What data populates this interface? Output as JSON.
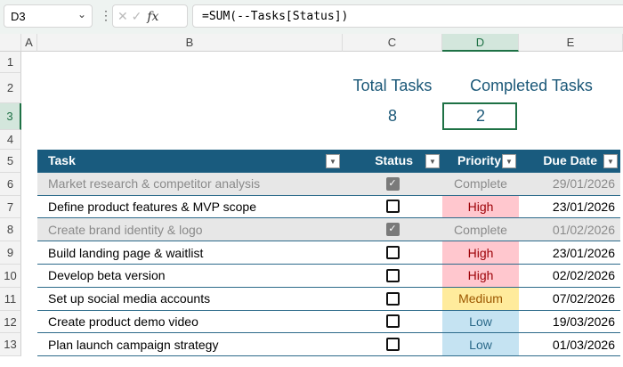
{
  "formula_bar": {
    "name_box": "D3",
    "formula": "=SUM(--Tasks[Status])",
    "fx": "fx",
    "cancel": "✕",
    "enter": "✓"
  },
  "columns": [
    "A",
    "B",
    "C",
    "D",
    "E"
  ],
  "rows": [
    "1",
    "2",
    "3",
    "4",
    "5",
    "6",
    "7",
    "8",
    "9",
    "10",
    "11",
    "12",
    "13"
  ],
  "summary": {
    "total_label": "Total Tasks",
    "completed_label": "Completed Tasks",
    "total_value": "8",
    "completed_value": "2"
  },
  "table": {
    "headers": [
      "Task",
      "Status",
      "Priority",
      "Due Date"
    ],
    "rows": [
      {
        "task": "Market research & competitor analysis",
        "done": true,
        "priority": "Complete",
        "due": "29/01/2026"
      },
      {
        "task": "Define product features & MVP scope",
        "done": false,
        "priority": "High",
        "due": "23/01/2026"
      },
      {
        "task": "Create brand identity & logo",
        "done": true,
        "priority": "Complete",
        "due": "01/02/2026"
      },
      {
        "task": "Build landing page & waitlist",
        "done": false,
        "priority": "High",
        "due": "23/01/2026"
      },
      {
        "task": "Develop beta version",
        "done": false,
        "priority": "High",
        "due": "02/02/2026"
      },
      {
        "task": "Set up social media accounts",
        "done": false,
        "priority": "Medium",
        "due": "07/02/2026"
      },
      {
        "task": "Create product demo video",
        "done": false,
        "priority": "Low",
        "due": "19/03/2026"
      },
      {
        "task": "Plan launch campaign strategy",
        "done": false,
        "priority": "Low",
        "due": "01/03/2026"
      }
    ]
  },
  "colors": {
    "header": "#195b7e",
    "accent": "#1e7145",
    "high": "#ffc7ce",
    "medium": "#ffeb9c",
    "low": "#c5e3f2"
  }
}
